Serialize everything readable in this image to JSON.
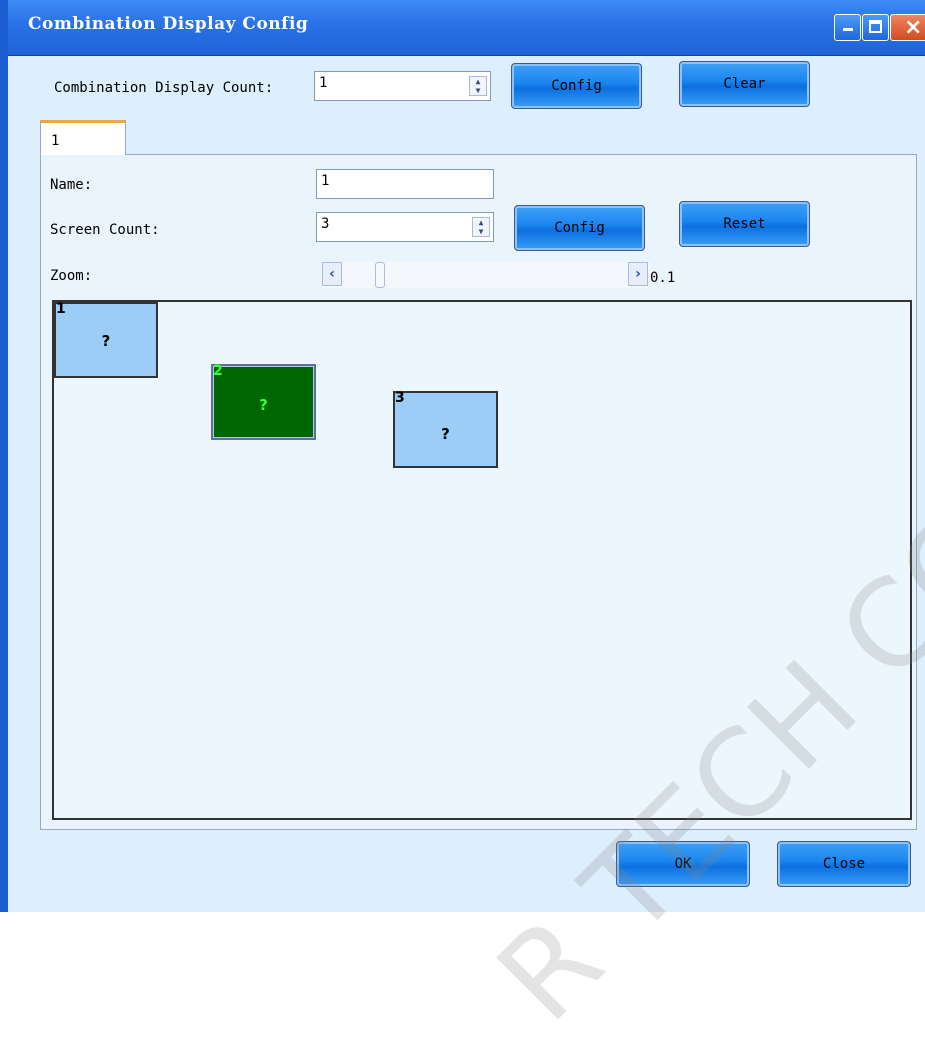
{
  "window": {
    "title": "Combination Display Config",
    "controls": {
      "minimize": "minimize",
      "maximize": "maximize",
      "close": "×"
    }
  },
  "top": {
    "count_label": "Combination Display Count:",
    "count_value": "1",
    "config_label": "Config",
    "clear_label": "Clear"
  },
  "tabs": [
    {
      "label": "1"
    }
  ],
  "panel": {
    "name_label": "Name:",
    "name_value": "1",
    "screen_count_label": "Screen Count:",
    "screen_count_value": "3",
    "config_label": "Config",
    "reset_label": "Reset",
    "zoom_label": "Zoom:",
    "zoom_value": "0.1"
  },
  "screens": [
    {
      "number": "1",
      "mark": "?",
      "fill": "#9ccdf6",
      "number_color": "#000000",
      "mark_color": "#000000",
      "border": "#333333"
    },
    {
      "number": "2",
      "mark": "?",
      "fill": "#006600",
      "number_color": "#33ff33",
      "mark_color": "#33ff33",
      "border": "#5c6fa0"
    },
    {
      "number": "3",
      "mark": "?",
      "fill": "#9ccdf6",
      "number_color": "#000000",
      "mark_color": "#000000",
      "border": "#333333"
    }
  ],
  "footer": {
    "ok_label": "OK",
    "close_label": "Close"
  },
  "watermark": "R TECH CO.,"
}
